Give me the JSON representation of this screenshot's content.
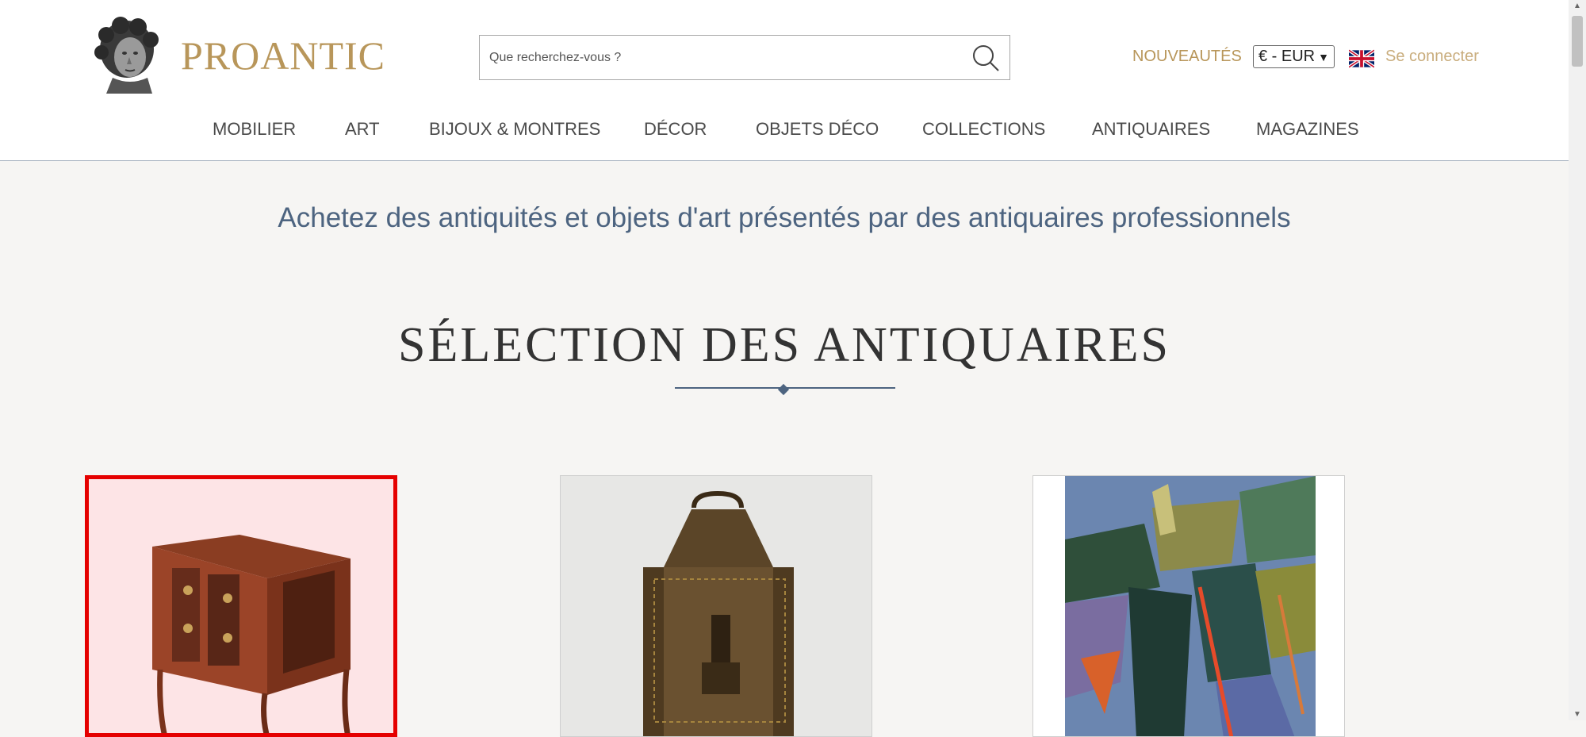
{
  "header": {
    "logo_text": "PROANTIC",
    "search_placeholder": "Que recherchez-vous ?",
    "news_label": "NOUVEAUTÉS",
    "currency_selected": "€ - EUR",
    "login_label": "Se connecter"
  },
  "nav": {
    "items": [
      {
        "label": "MOBILIER"
      },
      {
        "label": "ART"
      },
      {
        "label": "BIJOUX & MONTRES"
      },
      {
        "label": "DÉCOR"
      },
      {
        "label": "OBJETS DÉCO"
      },
      {
        "label": "COLLECTIONS"
      },
      {
        "label": "ANTIQUAIRES"
      },
      {
        "label": "MAGAZINES"
      }
    ]
  },
  "main": {
    "tagline": "Achetez des antiquités et objets d'art présentés par des antiquaires professionnels",
    "section_title": "SÉLECTION DES ANTIQUAIRES"
  },
  "colors": {
    "gold": "#b8965a",
    "slate_blue": "#4d6480",
    "selection_red": "#e50000"
  }
}
